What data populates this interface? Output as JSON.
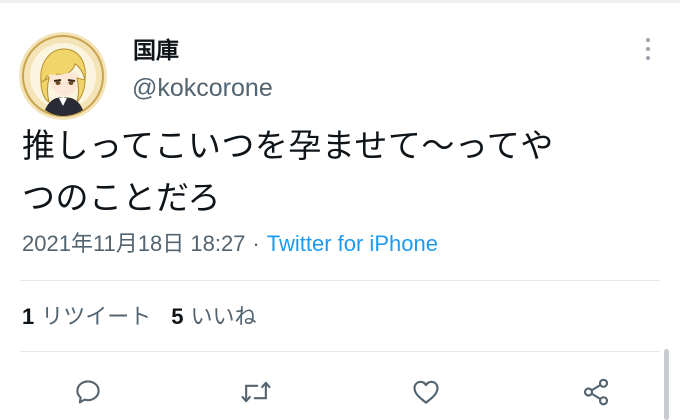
{
  "user": {
    "display_name": "国庫",
    "handle": "@kokcorone",
    "avatar_icon": "anime-character-avatar-icon"
  },
  "tweet": {
    "text_lines": [
      "推しってこいつを孕ませて〜ってや",
      "つのことだろ"
    ],
    "timestamp": "2021年11月18日 18:27",
    "separator": "·",
    "source": "Twitter for iPhone"
  },
  "stats": {
    "retweets": {
      "count": "1",
      "label": "リツイート"
    },
    "likes": {
      "count": "5",
      "label": "いいね"
    }
  },
  "actions": [
    {
      "name": "reply",
      "icon": "speech-bubble-icon"
    },
    {
      "name": "retweet",
      "icon": "retweet-arrows-icon"
    },
    {
      "name": "like",
      "icon": "heart-icon"
    },
    {
      "name": "share",
      "icon": "share-icon"
    }
  ],
  "colors": {
    "text": "#0f1419",
    "secondary": "#536471",
    "accent": "#1d9bf0",
    "divider": "#e3e7ea"
  }
}
